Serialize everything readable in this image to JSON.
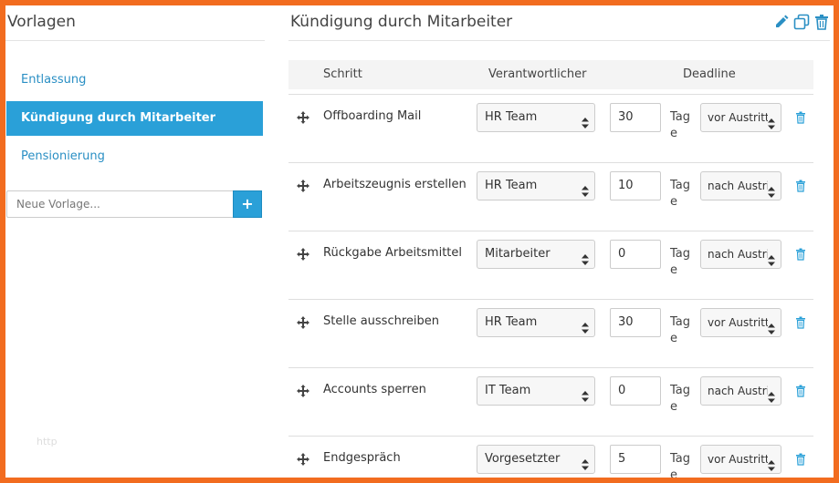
{
  "sidebar": {
    "title": "Vorlagen",
    "items": [
      {
        "label": "Entlassung",
        "active": false
      },
      {
        "label": "Kündigung durch Mitarbeiter",
        "active": true
      },
      {
        "label": "Pensionierung",
        "active": false
      }
    ],
    "new_template_placeholder": "Neue Vorlage...",
    "add_label": "+",
    "watermark": "http"
  },
  "main": {
    "title": "Kündigung durch Mitarbeiter",
    "header_icons": [
      "pencil-icon",
      "copy-icon",
      "trash-icon"
    ],
    "columns": {
      "step": "Schritt",
      "owner": "Verantwortlicher",
      "deadline": "Deadline"
    },
    "days_label": "Tage",
    "rows": [
      {
        "step": "Offboarding Mail",
        "owner": "HR Team",
        "days": "30",
        "relation": "vor Austritt"
      },
      {
        "step": "Arbeitszeugnis erstellen",
        "owner": "HR Team",
        "days": "10",
        "relation": "nach Austritt"
      },
      {
        "step": "Rückgabe Arbeitsmittel",
        "owner": "Mitarbeiter",
        "days": "0",
        "relation": "nach Austritt"
      },
      {
        "step": "Stelle ausschreiben",
        "owner": "HR Team",
        "days": "30",
        "relation": "vor Austritt"
      },
      {
        "step": "Accounts sperren",
        "owner": "IT Team",
        "days": "0",
        "relation": "nach Austritt"
      },
      {
        "step": "Endgespräch",
        "owner": "Vorgesetzter",
        "days": "5",
        "relation": "vor Austritt"
      }
    ]
  },
  "colors": {
    "accent": "#2aa0d8",
    "frame": "#f26c1f",
    "link": "#2a8fc4"
  }
}
